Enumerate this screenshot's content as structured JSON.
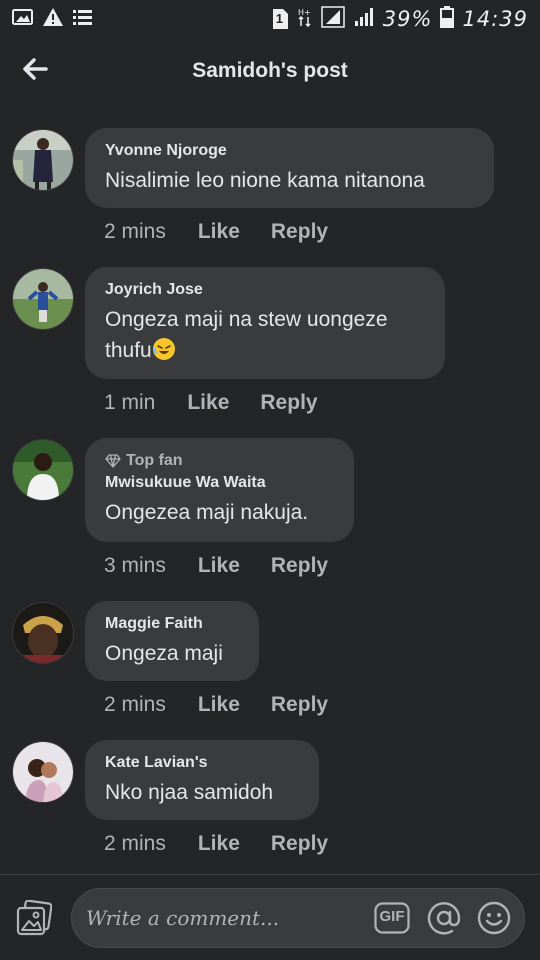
{
  "status_bar": {
    "battery_percent": "39%",
    "time": "14:39",
    "sim_slot": "1",
    "icons": [
      "gallery-icon",
      "warning-icon",
      "list-icon",
      "sim-icon",
      "data-icon",
      "signal-icon",
      "battery-icon"
    ]
  },
  "header": {
    "title": "Samidoh's post",
    "back_icon": "arrow-left-icon"
  },
  "comments": [
    {
      "author": "Yvonne Njoroge",
      "text": "Nisalimie leo nione kama nitanona",
      "time": "2 mins",
      "like": "Like",
      "reply": "Reply"
    },
    {
      "author": "Joyrich Jose",
      "text": "Ongeza maji na stew uongeze thufu",
      "emoji": "rolling-laughing-emoji",
      "time": "1 min",
      "like": "Like",
      "reply": "Reply"
    },
    {
      "badge": "Top fan",
      "author": "Mwisukuue Wa Waita",
      "text": "Ongezea maji nakuja.",
      "time": "3 mins",
      "like": "Like",
      "reply": "Reply"
    },
    {
      "author": "Maggie Faith",
      "text": "Ongeza maji",
      "time": "2 mins",
      "like": "Like",
      "reply": "Reply"
    },
    {
      "author": "Kate Lavian's",
      "text": "Nko njaa samidoh",
      "time": "2 mins",
      "like": "Like",
      "reply": "Reply"
    }
  ],
  "composer": {
    "placeholder": "Write a comment...",
    "gif_label": "GIF"
  },
  "colors": {
    "background": "#242526",
    "bubble": "#3a3b3c",
    "secondary_text": "#b0b3b8",
    "primary_text": "#e4e6eb"
  }
}
